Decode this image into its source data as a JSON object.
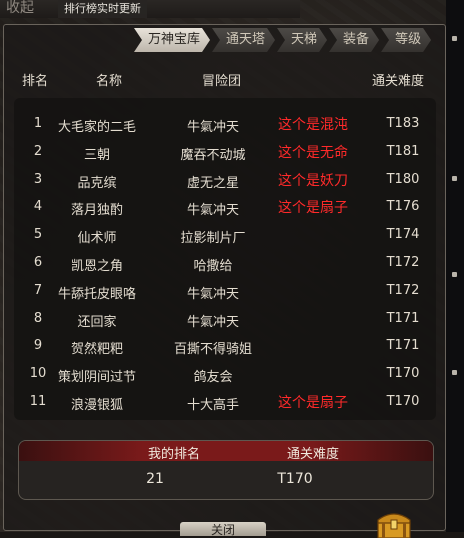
{
  "top_bar": {
    "collapse_label": "收起",
    "ticker_text": "排行榜实时更新"
  },
  "tabs": [
    {
      "label": "万神宝库",
      "active": true
    },
    {
      "label": "通天塔",
      "active": false
    },
    {
      "label": "天梯",
      "active": false
    },
    {
      "label": "装备",
      "active": false
    },
    {
      "label": "等级",
      "active": false
    }
  ],
  "table": {
    "headers": {
      "rank": "排名",
      "name": "名称",
      "group": "冒险团",
      "difficulty": "通关难度"
    },
    "rows": [
      {
        "rank": "1",
        "name": "大毛家的二毛",
        "group": "牛氣冲天",
        "note": "这个是混沌",
        "difficulty": "T183"
      },
      {
        "rank": "2",
        "name": "三朝",
        "group": "魔吞不动城",
        "note": "这个是无命",
        "difficulty": "T181"
      },
      {
        "rank": "3",
        "name": "品克缤",
        "group": "虚无之星",
        "note": "这个是妖刀",
        "difficulty": "T180"
      },
      {
        "rank": "4",
        "name": "落月独酌",
        "group": "牛氣冲天",
        "note": "这个是扇子",
        "difficulty": "T176"
      },
      {
        "rank": "5",
        "name": "仙术师",
        "group": "拉影制片厂",
        "note": "",
        "difficulty": "T174"
      },
      {
        "rank": "6",
        "name": "凯恩之角",
        "group": "哈撒给",
        "note": "",
        "difficulty": "T172"
      },
      {
        "rank": "7",
        "name": "牛舔托皮眼咯",
        "group": "牛氣冲天",
        "note": "",
        "difficulty": "T172"
      },
      {
        "rank": "8",
        "name": "还回家",
        "group": "牛氣冲天",
        "note": "",
        "difficulty": "T171"
      },
      {
        "rank": "9",
        "name": "贺然粑粑",
        "group": "百撕不得骑姐",
        "note": "",
        "difficulty": "T171"
      },
      {
        "rank": "10",
        "name": "策划阴间过节",
        "group": "鸽友会",
        "note": "",
        "difficulty": "T170"
      },
      {
        "rank": "11",
        "name": "浪漫银狐",
        "group": "十大高手",
        "note": "这个是扇子",
        "difficulty": "T170"
      }
    ]
  },
  "my_rank": {
    "rank_label": "我的排名",
    "difficulty_label": "通关难度",
    "rank_value": "21",
    "difficulty_value": "T170"
  },
  "bottom_button_label": "关闭",
  "colors": {
    "note_red": "#ff2a2a",
    "my_header_red": "#7a1a1a",
    "active_tab": "#e8e3da"
  }
}
